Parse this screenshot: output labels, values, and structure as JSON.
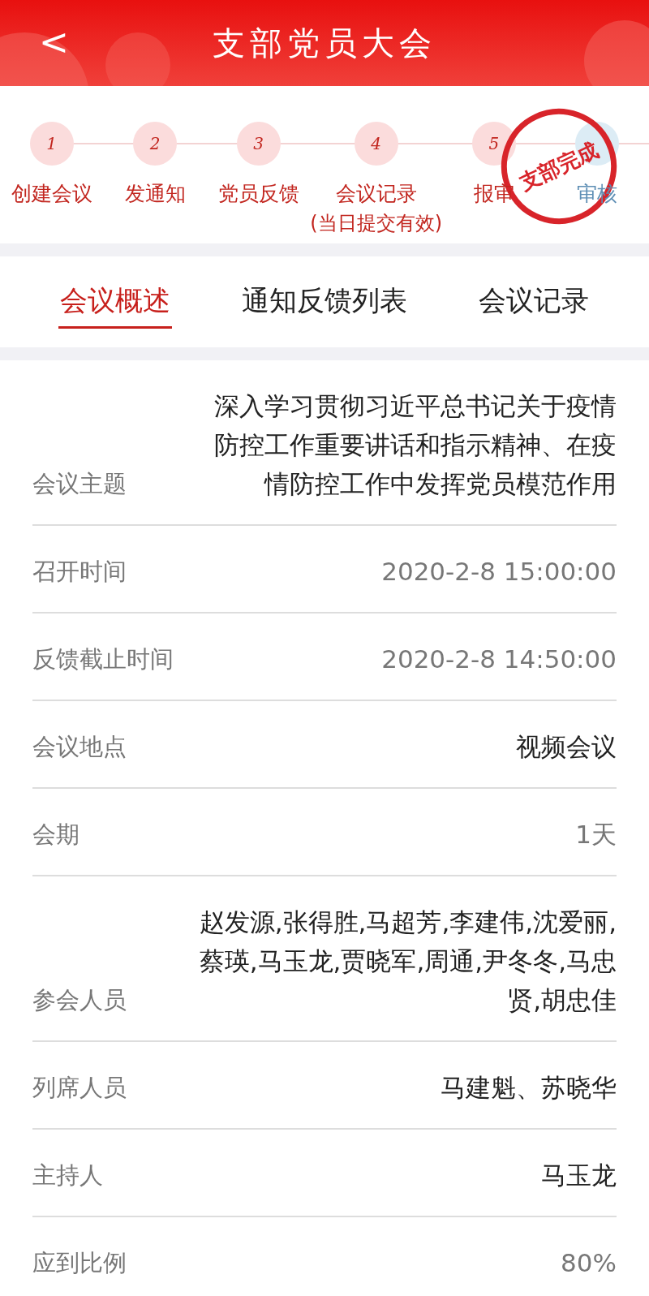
{
  "header": {
    "back": "<",
    "title": "支部党员大会"
  },
  "steps": [
    {
      "number": "1",
      "label": "创建会议",
      "done": true
    },
    {
      "number": "2",
      "label": "发通知",
      "done": true
    },
    {
      "number": "3",
      "label": "党员反馈",
      "done": true
    },
    {
      "number": "4",
      "label": "会议记录",
      "note": "(当日提交有效)",
      "done": true
    },
    {
      "number": "5",
      "label": "报审",
      "done": true
    },
    {
      "label": "审核",
      "done": false
    }
  ],
  "stamp": "支部完成",
  "tabs": [
    {
      "label": "会议概述",
      "selected": true
    },
    {
      "label": "通知反馈列表",
      "selected": false
    },
    {
      "label": "会议记录",
      "selected": false
    }
  ],
  "rows": [
    {
      "label": "会议主题",
      "value": "深入学习贯彻习近平总书记关于疫情防控工作重要讲话和指示精神、在疫情防控工作中发挥党员模范作用",
      "strong": true
    },
    {
      "label": "召开时间",
      "value": "2020-2-8 15:00:00",
      "strong": false
    },
    {
      "label": "反馈截止时间",
      "value": "2020-2-8 14:50:00",
      "strong": false
    },
    {
      "label": "会议地点",
      "value": "视频会议",
      "strong": true
    },
    {
      "label": "会期",
      "value": "1天",
      "strong": false
    },
    {
      "label": "参会人员",
      "value": "赵发源,张得胜,马超芳,李建伟,沈爱丽,蔡瑛,马玉龙,贾晓军,周通,尹冬冬,马忠贤,胡忠佳",
      "strong": true
    },
    {
      "label": "列席人员",
      "value": "马建魁、苏晓华",
      "strong": true
    },
    {
      "label": "主持人",
      "value": "马玉龙",
      "strong": true
    },
    {
      "label": "应到比例",
      "value": "80%",
      "strong": false
    }
  ]
}
